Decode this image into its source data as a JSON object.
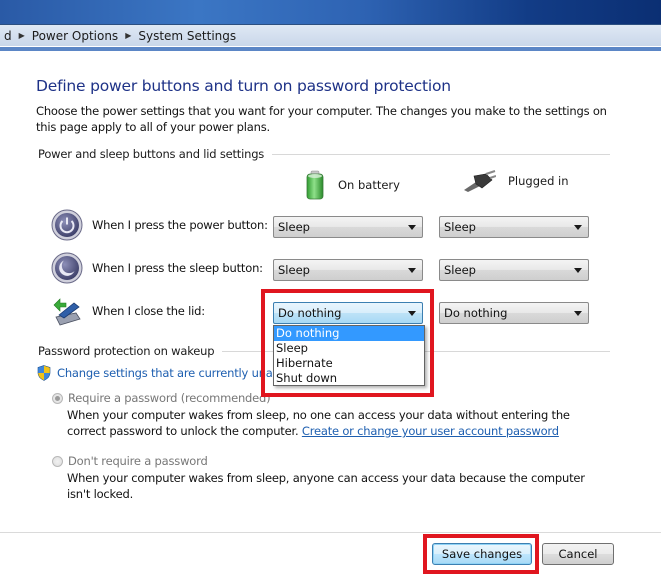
{
  "window": {
    "breadcrumb": [
      "d",
      "Power Options",
      "System Settings"
    ]
  },
  "main": {
    "title": "Define power buttons and turn on password protection",
    "intro": "Choose the power settings that you want for your computer. The changes you make to the settings on this page apply to all of your power plans.",
    "buttons_section": {
      "header": "Power and sleep buttons and lid settings",
      "columns": [
        {
          "label": "On battery",
          "icon": "battery-icon"
        },
        {
          "label": "Plugged in",
          "icon": "power-plug-icon"
        }
      ],
      "rows": [
        {
          "label": "When I press the power button:",
          "icon": "power-button-icon",
          "on_battery": "Sleep",
          "plugged_in": "Sleep"
        },
        {
          "label": "When I press the sleep button:",
          "icon": "sleep-button-icon",
          "on_battery": "Sleep",
          "plugged_in": "Sleep"
        },
        {
          "label": "When I close the lid:",
          "icon": "laptop-lid-icon",
          "on_battery": "Do nothing",
          "plugged_in": "Do nothing"
        }
      ],
      "open_dropdown": {
        "options": [
          "Do nothing",
          "Sleep",
          "Hibernate",
          "Shut down"
        ],
        "selected": "Do nothing"
      }
    },
    "password_section": {
      "header": "Password protection on wakeup",
      "change_settings_link": "Change settings that are currently unavai",
      "options": [
        {
          "label": "Require a password (recommended)",
          "checked": true,
          "description": "When your computer wakes from sleep, no one can access your data without entering the correct password to unlock the computer.",
          "link": "Create or change your user account password"
        },
        {
          "label": "Don't require a password",
          "checked": false,
          "description": "When your computer wakes from sleep, anyone can access your data because the computer isn't locked."
        }
      ]
    }
  },
  "footer": {
    "save_label": "Save changes",
    "cancel_label": "Cancel"
  },
  "colors": {
    "title": "#1e3287",
    "link": "#1e5fb0",
    "highlight": "#e0161f",
    "selection": "#3399ff"
  }
}
